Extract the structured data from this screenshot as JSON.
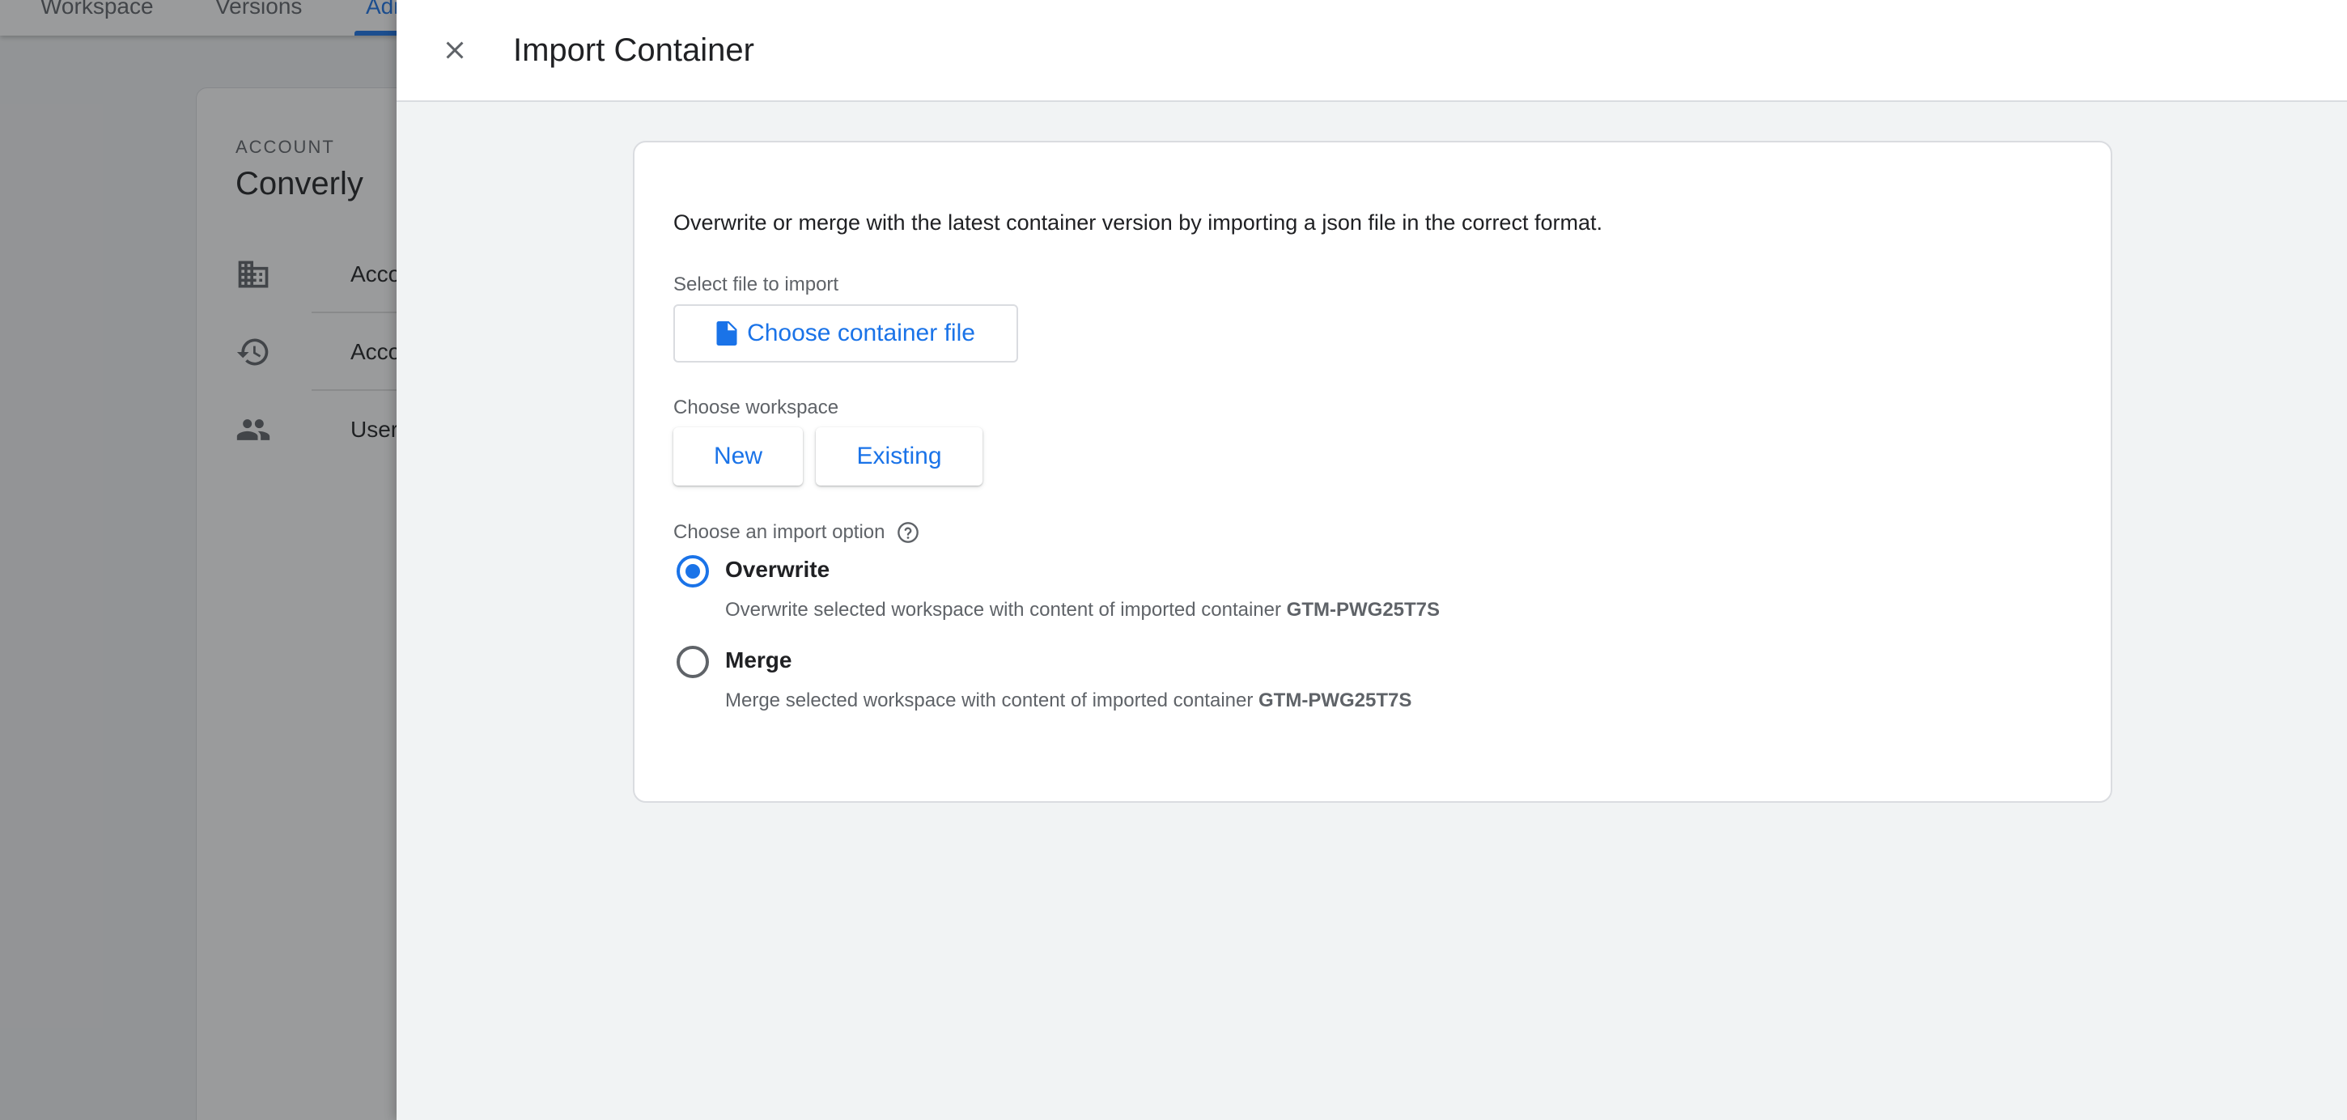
{
  "background": {
    "tabs": [
      "Workspace",
      "Versions",
      "Admin"
    ],
    "account_eyebrow": "ACCOUNT",
    "account_name": "Converly",
    "nav_items": [
      {
        "label": "Account Settings",
        "icon": "building-icon"
      },
      {
        "label": "Account Activity",
        "icon": "history-icon"
      },
      {
        "label": "User Management",
        "icon": "people-icon"
      }
    ]
  },
  "panel": {
    "title": "Import Container",
    "intro": "Overwrite or merge with the latest container version by importing a json file in the correct format.",
    "file_label": "Select file to import",
    "file_button": "Choose container file",
    "workspace_label": "Choose workspace",
    "workspace_new": "New",
    "workspace_existing": "Existing",
    "import_option_label": "Choose an import option",
    "options": [
      {
        "title": "Overwrite",
        "desc": "Overwrite selected workspace with content of imported container",
        "container": "GTM-PWG25T7S",
        "selected": true
      },
      {
        "title": "Merge",
        "desc": "Merge selected workspace with content of imported container",
        "container": "GTM-PWG25T7S",
        "selected": false
      }
    ]
  },
  "colors": {
    "accent": "#1a73e8",
    "text_primary": "#202124",
    "text_secondary": "#5f6368",
    "panel_bg": "#f1f3f4"
  }
}
